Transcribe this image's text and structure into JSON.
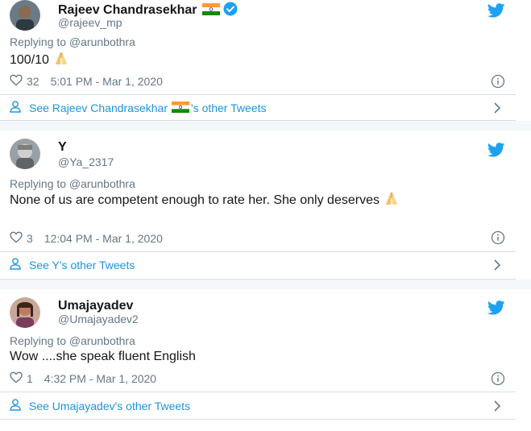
{
  "colors": {
    "link": "#1b95e0",
    "muted": "#657786",
    "text": "#14171a",
    "verified": "#1da1f2"
  },
  "tweets": [
    {
      "name": "Rajeev Chandrasekhar",
      "handle": "@rajeev_mp",
      "replying": "Replying to @arunbothra",
      "text": "100/10",
      "likes": "32",
      "time": "5:01 PM - Mar 1, 2020",
      "see_prefix": "See Rajeev Chandrasekhar",
      "see_suffix": "'s other Tweets",
      "icons": [
        "india-flag-icon",
        "verified-badge-icon",
        "twitter-bird-icon",
        "folded-hands-icon",
        "heart-icon",
        "info-icon",
        "person-icon",
        "chevron-right-icon"
      ]
    },
    {
      "name": "Y",
      "handle": "@Ya_2317",
      "replying": "Replying to @arunbothra",
      "text": "None of us are competent enough to rate her. She only deserves",
      "likes": "3",
      "time": "12:04 PM - Mar 1, 2020",
      "see_prefix": "See Y's other Tweets",
      "icons": [
        "twitter-bird-icon",
        "folded-hands-icon",
        "heart-icon",
        "info-icon",
        "person-icon",
        "chevron-right-icon"
      ]
    },
    {
      "name": "Umajayadev",
      "handle": "@Umajayadev2",
      "replying": "Replying to @arunbothra",
      "text": "Wow ....she speak fluent English",
      "likes": "1",
      "time": "4:32 PM - Mar 1, 2020",
      "see_prefix": "See Umajayadev's other Tweets",
      "icons": [
        "twitter-bird-icon",
        "heart-icon",
        "info-icon",
        "person-icon",
        "chevron-right-icon"
      ]
    }
  ]
}
